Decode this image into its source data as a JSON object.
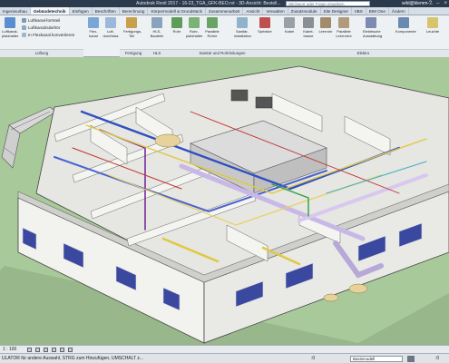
{
  "titlebar": {
    "title": "Autodesk Revit 2017 -   16-23_TGA_GFK-BEO.rvt - 3D-Ansicht: Bestell...",
    "search_placeholder": "Stichwort oder Frage eingeben",
    "user": "wild@klemm-..."
  },
  "tabs": [
    "Ingenieurbau",
    "Gebäudetechnik",
    "Einfügen",
    "Beschriften",
    "Berechnung",
    "Körpermodell & Grundstück",
    "Zusammenarbeit",
    "Ansicht",
    "Verwalten",
    "Zusatzmodule",
    "Site Designer",
    "IIBS",
    "BIM One",
    "Ändern"
  ],
  "ribbon": {
    "small_buttons": [
      "Luftkanal-formteil",
      "Luftkanalzubehör",
      "In Flexkanal konvertieren"
    ],
    "buttons": [
      {
        "label": "Luftkanal-platzhalter",
        "color": "#5a8fcf"
      },
      {
        "label": "Flex-kanal",
        "color": "#7aa6d6"
      },
      {
        "label": "Luft-durchlass",
        "color": "#9bb8d8"
      },
      {
        "label": "Fertigungs-Teil",
        "color": "#c9a04a"
      },
      {
        "label": "HLS-Bauteile",
        "color": "#8aa3bc"
      },
      {
        "label": "Rohr",
        "color": "#5f9c5a"
      },
      {
        "label": "Rohr-platzhalter",
        "color": "#7bb276"
      },
      {
        "label": "Parallele Rohre",
        "color": "#6aa465"
      },
      {
        "label": "Sanitär-installation",
        "color": "#8fb3c9"
      },
      {
        "label": "Sprinkler",
        "color": "#c05050"
      },
      {
        "label": "Kabel",
        "color": "#9aa0a8"
      },
      {
        "label": "Kabel-trasse",
        "color": "#8a8f96"
      },
      {
        "label": "Leerrohr",
        "color": "#a08c6a"
      },
      {
        "label": "Parallele Leerrohre",
        "color": "#b09c7a"
      },
      {
        "label": "Elektrische Ausstattung",
        "color": "#7d8ab2"
      },
      {
        "label": "Komponente",
        "color": "#6b8ab0"
      },
      {
        "label": "Leuchte",
        "color": "#d8c46a"
      }
    ],
    "panels": [
      "Lüftung",
      "Fertigung",
      "HLS",
      "Sanitär und Rohrleitungen",
      "Elektro"
    ]
  },
  "viewbar": {
    "scale": "1 : 100"
  },
  "statusbar": {
    "message": "ULATOR für andere Auswahl, STRG zum Hinzufügen, UMSCHALT z...",
    "zero": ":0",
    "model": "Basismodell",
    "right": ":0"
  }
}
